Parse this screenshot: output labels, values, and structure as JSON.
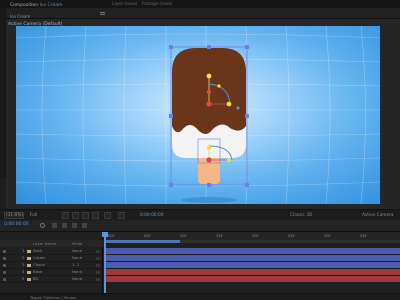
{
  "top_tabs": [
    "Layer (none)",
    "Footage (none)"
  ],
  "comp_panel": {
    "label": "Composition",
    "comp_name": "Ice Cream",
    "tab_name": "Ice Cream",
    "viewer_label": "Active Camera (Default)"
  },
  "viewer_bar": {
    "zoom": "(31.6%)",
    "resolution": "Full",
    "timecode": "0:00:00:00",
    "renderer": "Classic 3D",
    "camera": "Active Camera"
  },
  "timeline": {
    "timecode": "0:00:00:00",
    "columns": {
      "name": "Layer Name",
      "mode": "Mode"
    },
    "ruler_ticks": [
      "00f",
      "05f",
      "10f",
      "15f",
      "20f",
      "25f",
      "30f",
      "35f"
    ],
    "layers": [
      {
        "index": "1",
        "name": "Stick",
        "mode": "None"
      },
      {
        "index": "2",
        "name": "Cream",
        "mode": "None"
      },
      {
        "index": "3",
        "name": "Choco",
        "mode": "1. 2"
      },
      {
        "index": "4",
        "name": "Base",
        "mode": "None"
      },
      {
        "index": "5",
        "name": "BG",
        "mode": "None"
      }
    ],
    "footer_label": "Toggle Switches / Modes"
  },
  "colors": {
    "accent": "#4f93d6",
    "chocolate": "#6a3518",
    "cream": "#f3f3f3",
    "stick": "#f7b784",
    "bar_blue": "#4b5bb0",
    "bar_red": "#9a3a3a"
  }
}
